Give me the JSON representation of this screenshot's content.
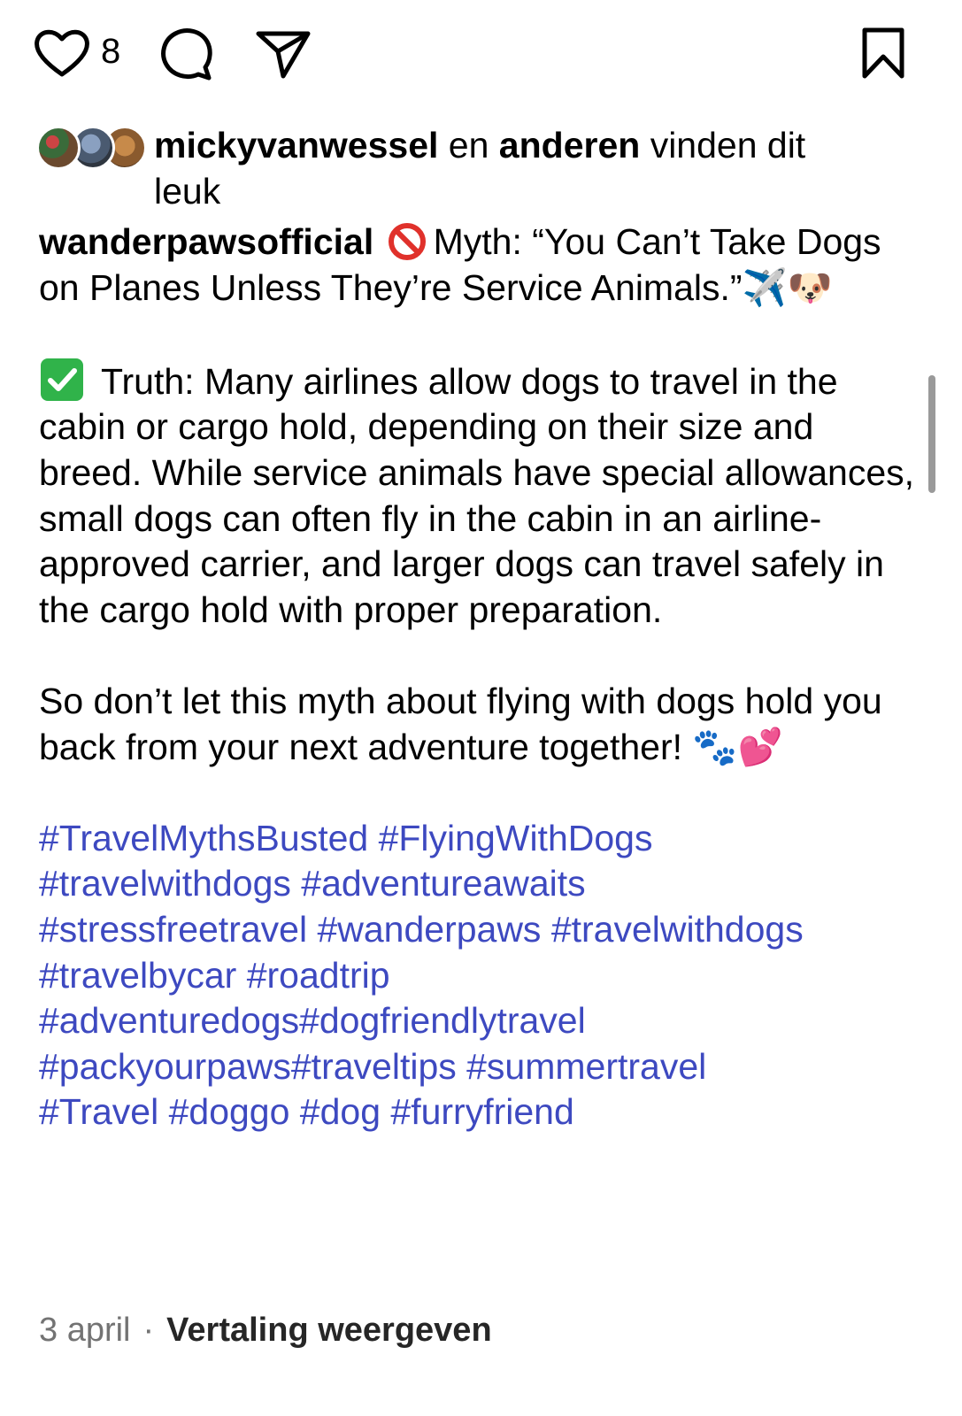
{
  "actions": {
    "like_count": "8",
    "icons": [
      "heart-icon",
      "comment-icon",
      "share-icon",
      "bookmark-icon"
    ]
  },
  "likes": {
    "user": "mickyvanwessel",
    "connector": " en ",
    "others": "anderen",
    "suffix": " vinden dit leuk"
  },
  "caption": {
    "username": "wanderpawsofficial",
    "myth_text": "Myth: “You Can’t Take Dogs on Planes Unless They’re Service Animals.”",
    "myth_emojis": "✈️🐶",
    "truth_text": "Truth: Many airlines allow dogs to travel in the cabin or cargo hold, depending on their size and breed. While service animals have special allowances, small dogs can often fly in the cabin in an airline-approved carrier, and larger dogs can travel safely in the cargo hold with proper preparation.",
    "closing_text": "So don’t let this myth about flying with dogs hold you back from your next adventure together!",
    "closing_emojis": "🐾💕",
    "hashtag_lines": [
      "#TravelMythsBusted #FlyingWithDogs",
      "#travelwithdogs #adventureawaits",
      "#stressfreetravel #wanderpaws #travelwithdogs",
      "#travelbycar #roadtrip",
      "#adventuredogs#dogfriendlytravel",
      "#packyourpaws#traveltips #summertravel",
      "#Travel #doggo #dog #furryfriend"
    ]
  },
  "footer": {
    "date": "3 april",
    "separator": "·",
    "translate_label": "Vertaling weergeven"
  },
  "colors": {
    "hashtag": "#3d49c0",
    "muted": "#737373",
    "check_green": "#30b34a",
    "no_entry_red": "#e0312b"
  }
}
